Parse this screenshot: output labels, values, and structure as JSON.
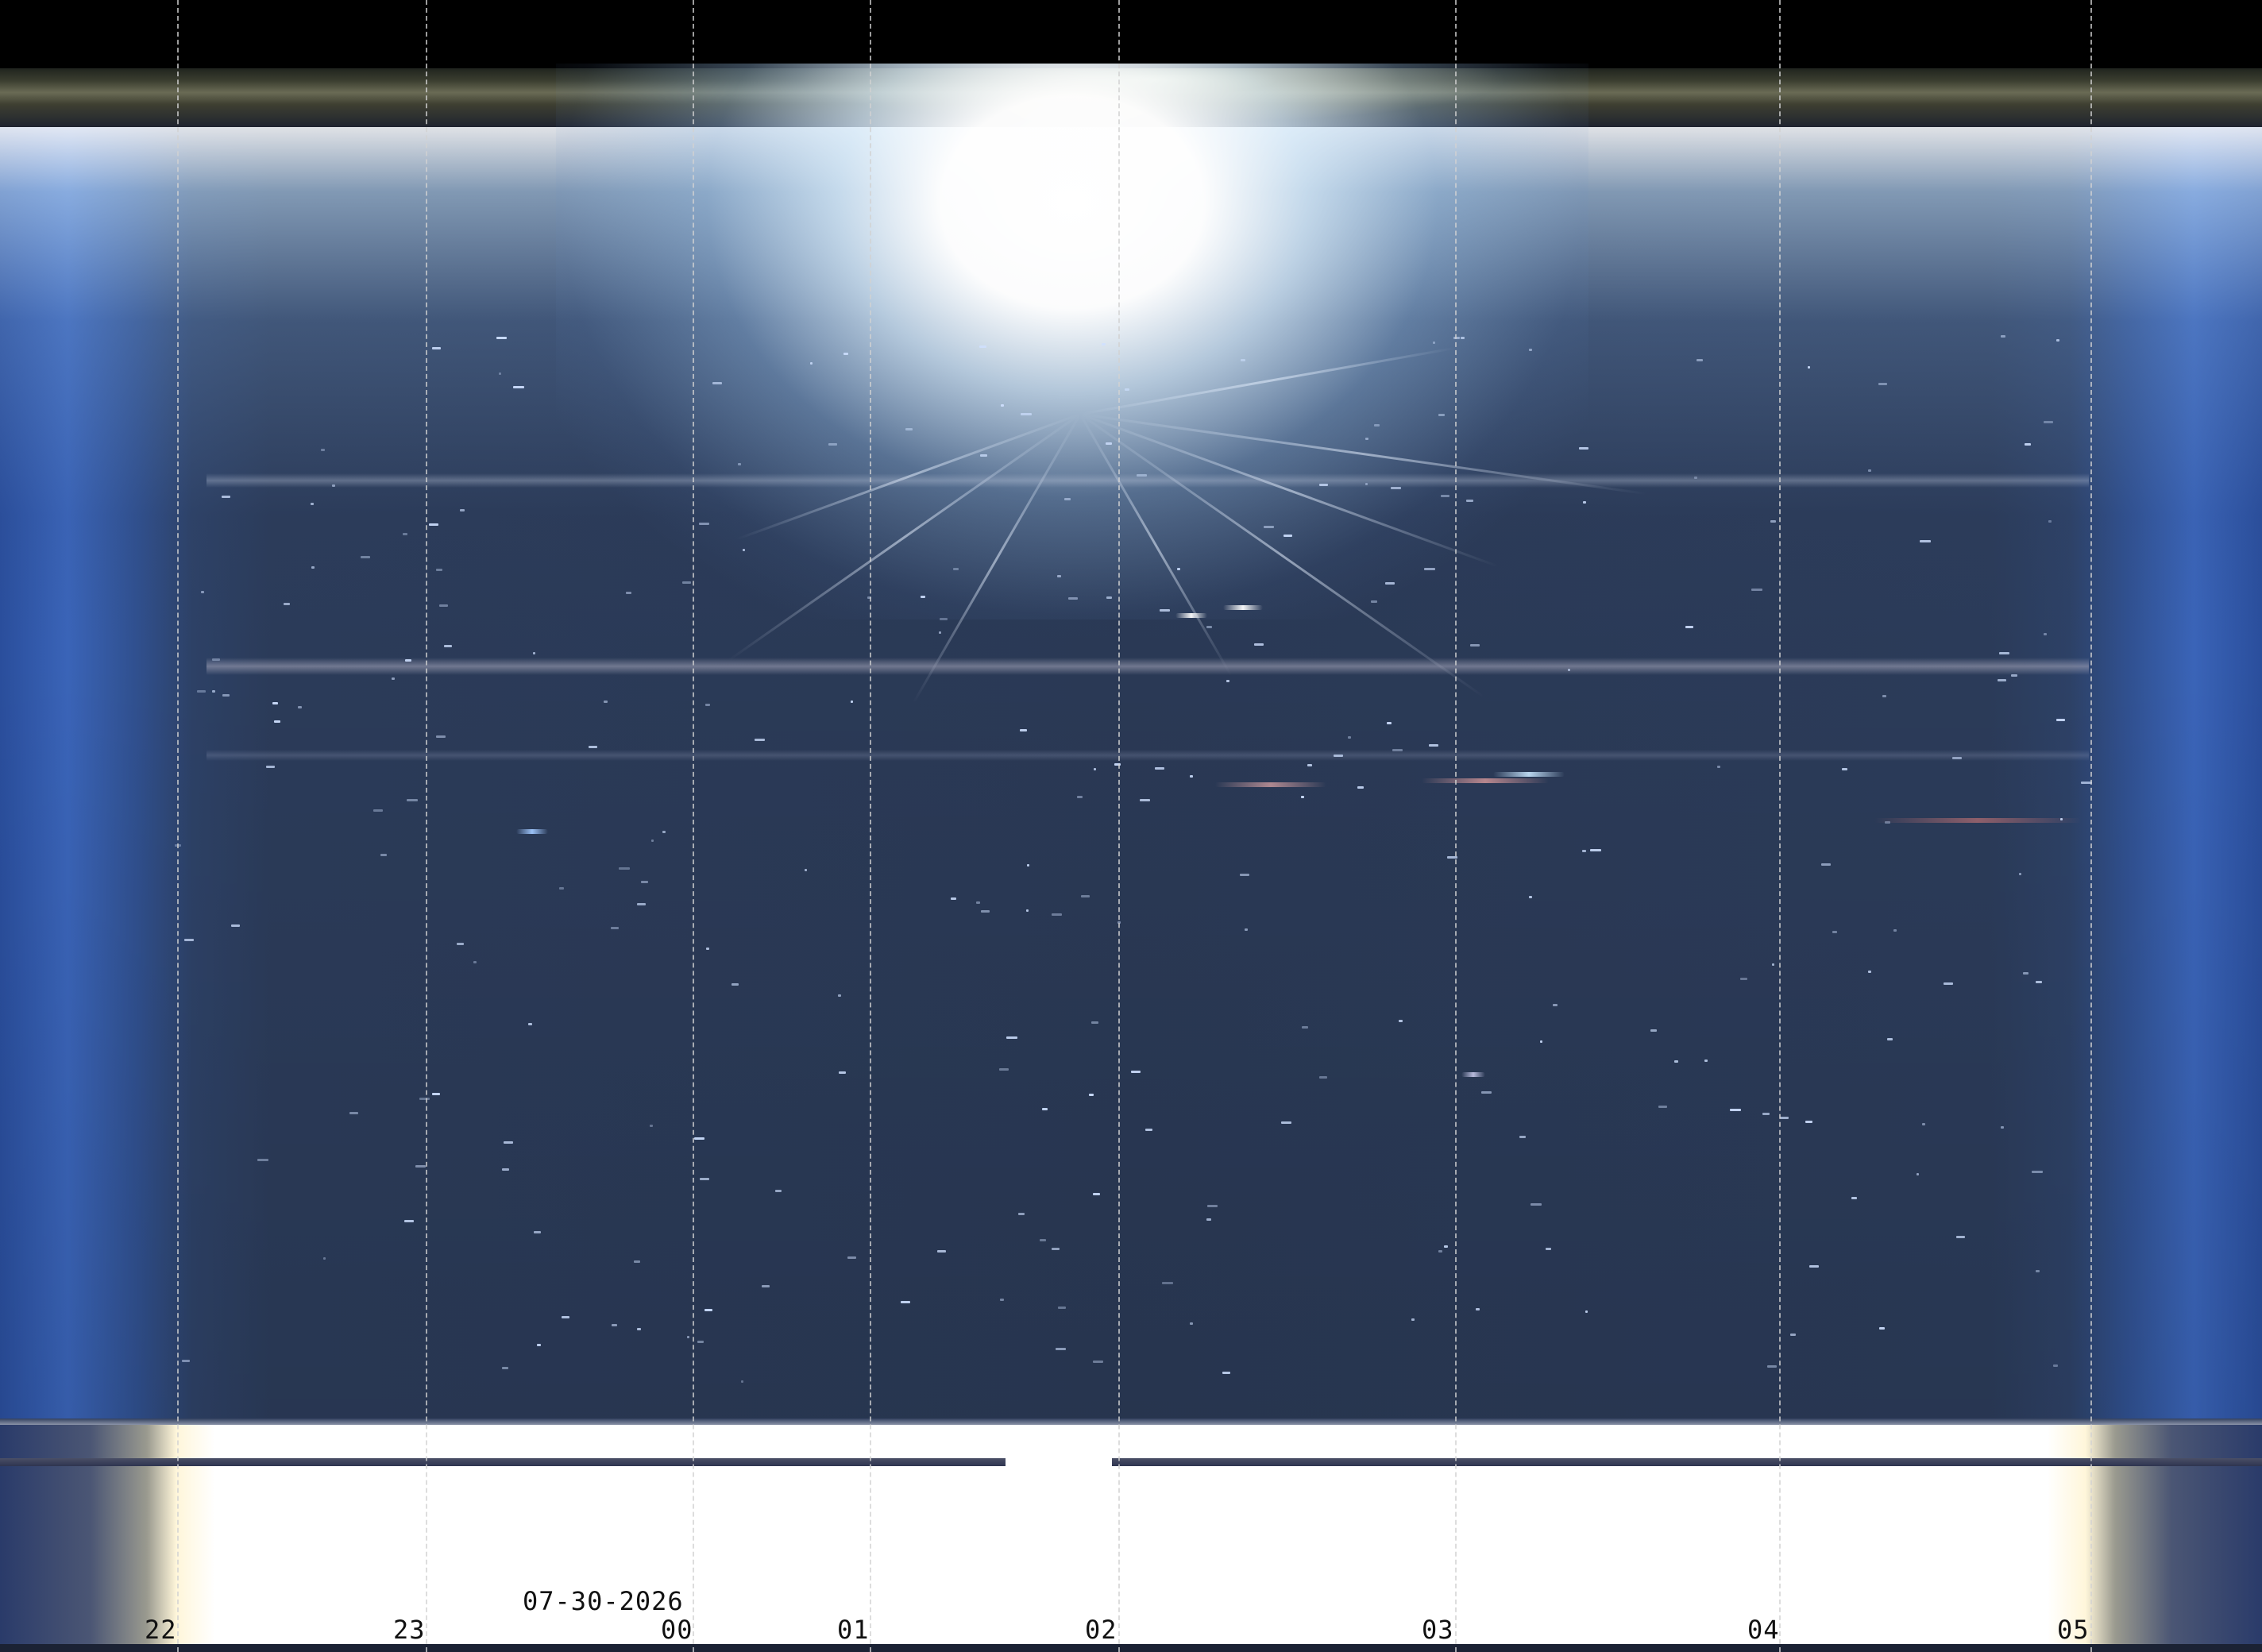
{
  "image": {
    "kind": "all-sky keogram",
    "date_label": "07-30-2026",
    "hour_ticks": [
      "22",
      "23",
      "00",
      "01",
      "02",
      "03",
      "04",
      "05"
    ]
  },
  "colors": {
    "sky_core": "#2a3955",
    "sky_edge_blue": "#3a64b8",
    "glare_white": "#ffffff",
    "gridline": "#d2d2d2",
    "label_text": "#111111"
  }
}
